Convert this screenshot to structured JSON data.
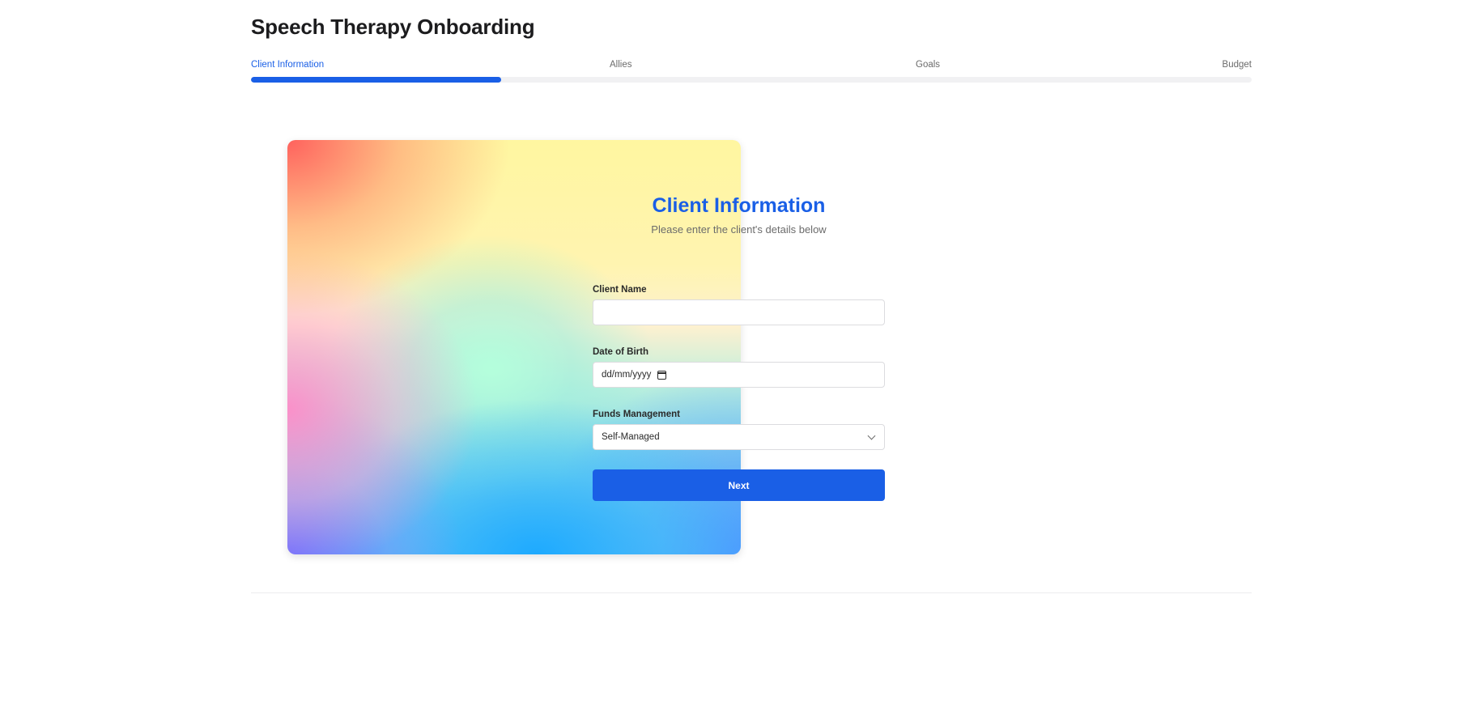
{
  "header": {
    "title": "Speech Therapy Onboarding"
  },
  "steps": {
    "items": [
      {
        "label": "Client Information",
        "active": true
      },
      {
        "label": "Allies",
        "active": false
      },
      {
        "label": "Goals",
        "active": false
      },
      {
        "label": "Budget",
        "active": false
      }
    ],
    "progress_percent": 25
  },
  "form": {
    "title": "Client Information",
    "subtitle": "Please enter the client's details below",
    "client_name": {
      "label": "Client Name",
      "value": "",
      "placeholder": ""
    },
    "date_of_birth": {
      "label": "Date of Birth",
      "value": "dd/mm/yyyy"
    },
    "funds_management": {
      "label": "Funds Management",
      "selected": "Self-Managed"
    },
    "next_label": "Next"
  },
  "colors": {
    "accent": "#1a5fe6",
    "track": "#f1f1f3"
  },
  "icons": {
    "date": "calendar-icon",
    "select": "chevron-down-icon"
  }
}
